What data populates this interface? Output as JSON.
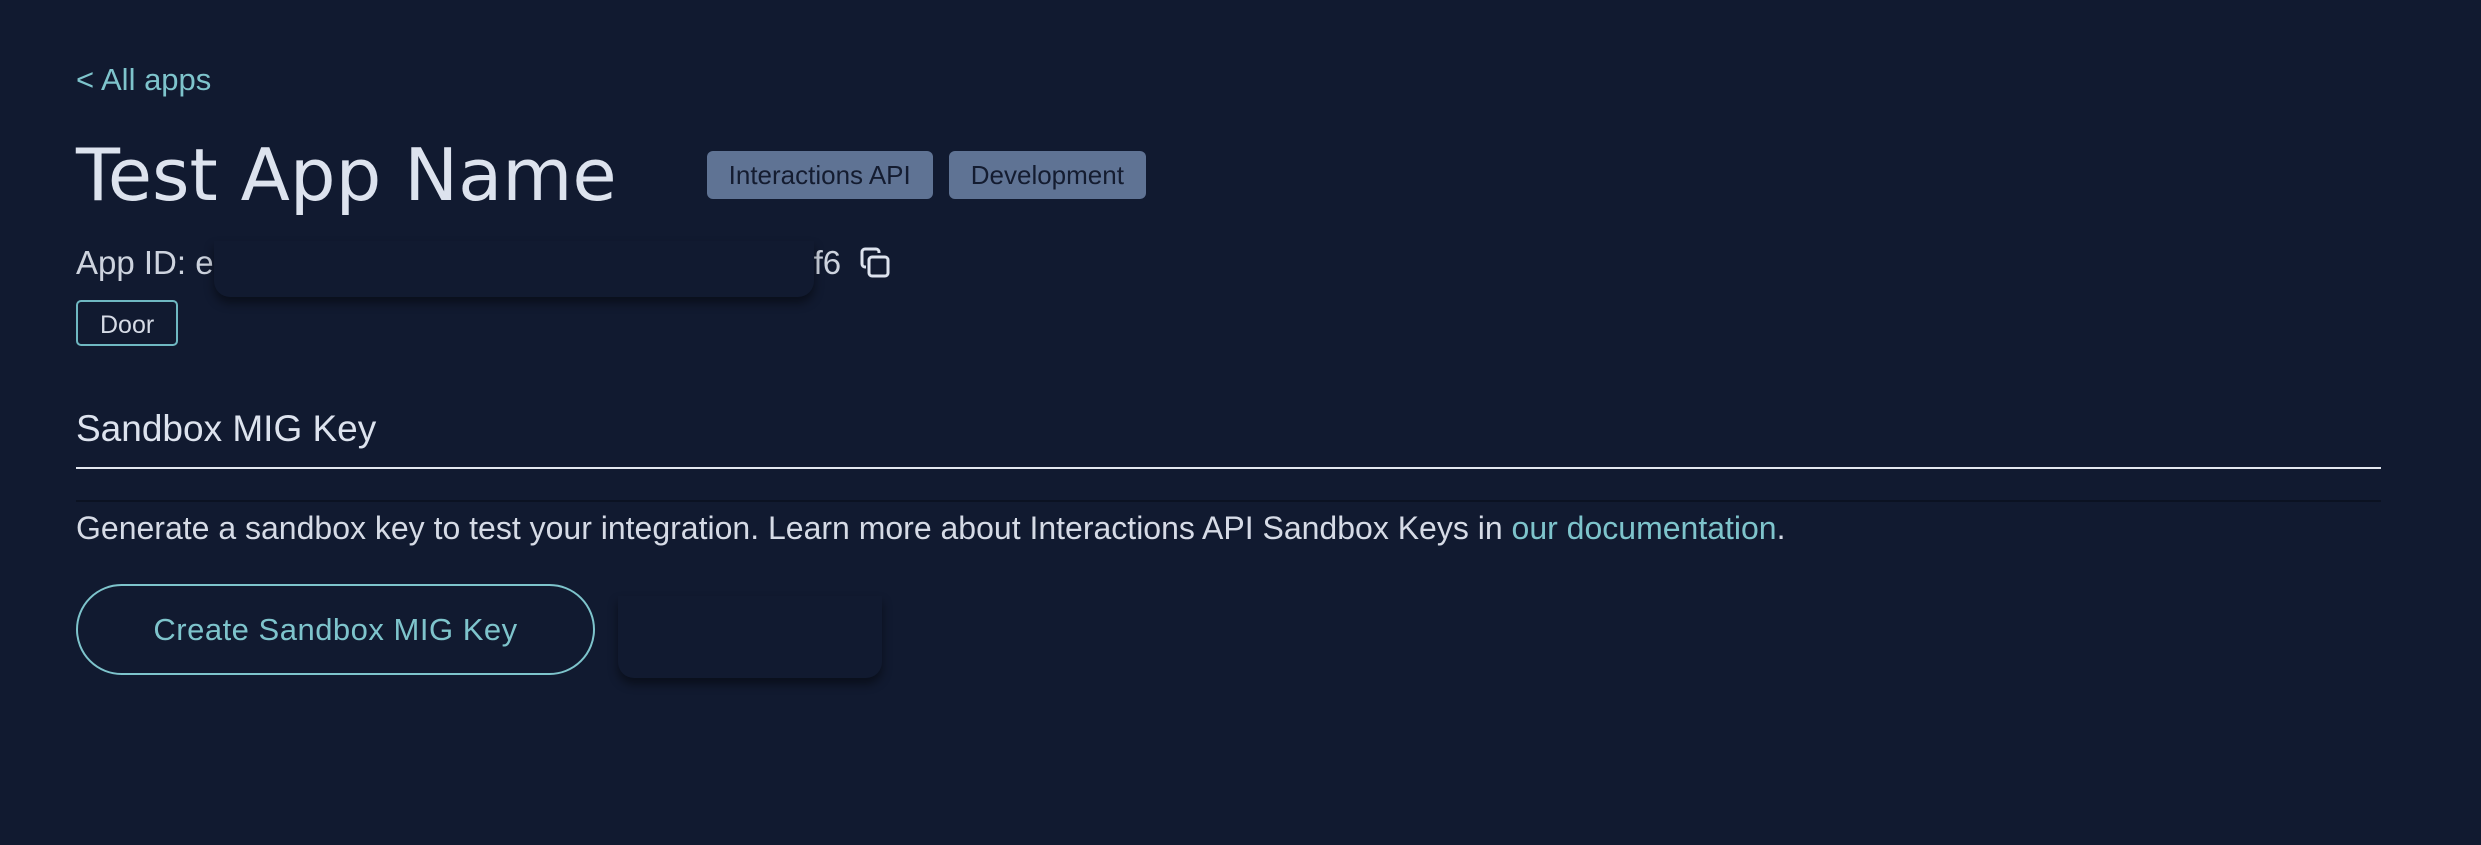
{
  "nav": {
    "back_label": "< All apps"
  },
  "app": {
    "title": "Test App Name",
    "badges": [
      "Interactions API",
      "Development"
    ],
    "id_label": "App ID: e",
    "id_tail": "f6",
    "tag": "Door"
  },
  "sandbox": {
    "section_title": "Sandbox MIG Key",
    "description_prefix": "Generate a sandbox key to test your integration. Learn more about Interactions API Sandbox Keys in ",
    "doc_link": "our documentation",
    "description_suffix": ".",
    "create_button": "Create Sandbox MIG Key"
  },
  "icons": {
    "copy": "copy-icon"
  },
  "colors": {
    "background": "#111a30",
    "accent": "#7ec4cc",
    "badge": "#5f7394"
  }
}
